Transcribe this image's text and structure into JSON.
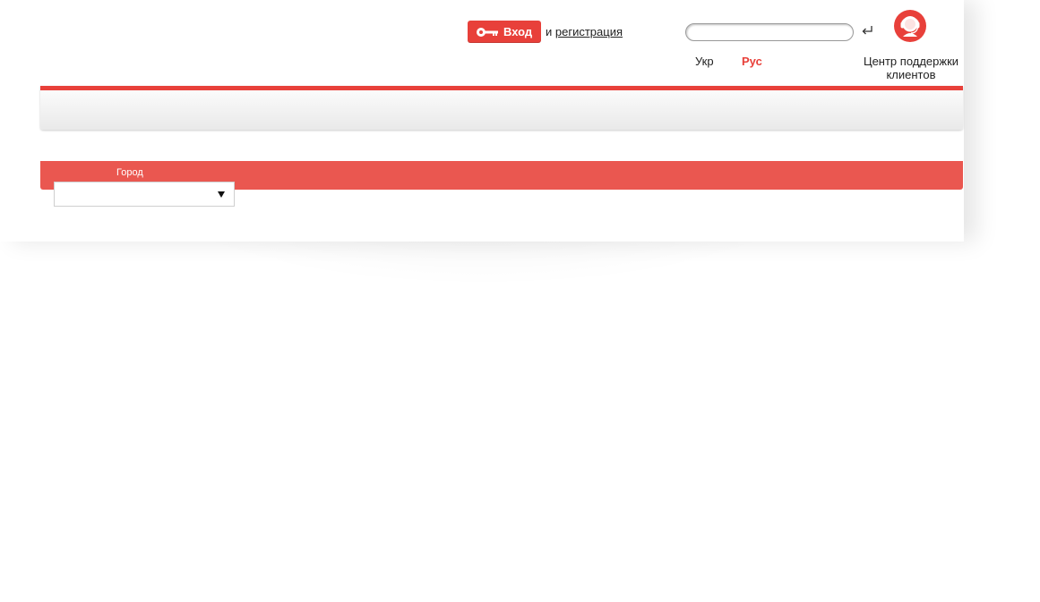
{
  "header": {
    "login_label": "Вход",
    "register_prefix": "и",
    "register_link": "регистрация",
    "search": {
      "value": "",
      "placeholder": ""
    },
    "languages": [
      {
        "label": "Укр",
        "active": false
      },
      {
        "label": "Рус",
        "active": true
      }
    ],
    "support_label": "Центр поддержки клиентов"
  },
  "city_filter": {
    "label": "Город",
    "selected": ""
  },
  "icons": {
    "login": "key-icon",
    "search_submit": "enter-arrow-icon",
    "support": "customer-support-icon",
    "dropdown": "dropdown-arrow-icon"
  },
  "colors": {
    "accent": "#e8403a",
    "city_bar": "#ea5750",
    "nav_bar_top": "#fbfbfb",
    "nav_bar_bottom": "#e9e9e9"
  }
}
